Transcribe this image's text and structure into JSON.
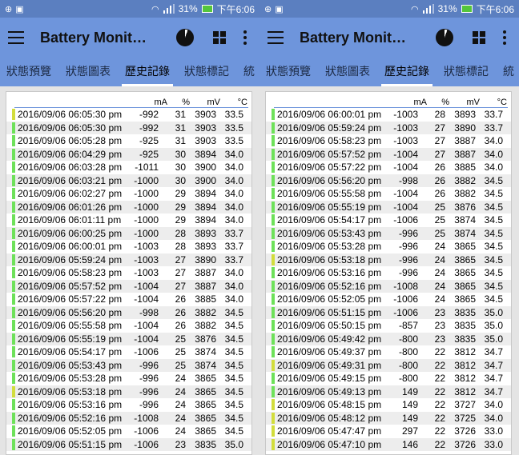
{
  "status_bar": {
    "battery_percent": "31%",
    "time": "下午6:06"
  },
  "app_bar": {
    "title": "Battery Monit…"
  },
  "tabs": [
    "狀態預覽",
    "狀態圖表",
    "歷史記錄",
    "狀態標記",
    "統"
  ],
  "active_tab": 2,
  "headers": {
    "ma": "mA",
    "pct": "%",
    "mv": "mV",
    "temp": "°C"
  },
  "colors": {
    "bar": "#6e95dc",
    "status": "#5b7fc0",
    "green": "#6ee15a",
    "yellow": "#d2dd3c"
  },
  "left_rows": [
    [
      "2016/09/06  06:05:30 pm",
      "-992",
      "31",
      "3903",
      "33.5",
      "yellow"
    ],
    [
      "2016/09/06  06:05:30 pm",
      "-992",
      "31",
      "3903",
      "33.5",
      "green"
    ],
    [
      "2016/09/06  06:05:28 pm",
      "-925",
      "31",
      "3903",
      "33.5",
      "green"
    ],
    [
      "2016/09/06  06:04:29 pm",
      "-925",
      "30",
      "3894",
      "34.0",
      "green"
    ],
    [
      "2016/09/06  06:03:28 pm",
      "-1011",
      "30",
      "3900",
      "34.0",
      "green"
    ],
    [
      "2016/09/06  06:03:21 pm",
      "-1000",
      "30",
      "3900",
      "34.0",
      "green"
    ],
    [
      "2016/09/06  06:02:27 pm",
      "-1000",
      "29",
      "3894",
      "34.0",
      "green"
    ],
    [
      "2016/09/06  06:01:26 pm",
      "-1000",
      "29",
      "3894",
      "34.0",
      "green"
    ],
    [
      "2016/09/06  06:01:11 pm",
      "-1000",
      "29",
      "3894",
      "34.0",
      "green"
    ],
    [
      "2016/09/06  06:00:25 pm",
      "-1000",
      "28",
      "3893",
      "33.7",
      "green"
    ],
    [
      "2016/09/06  06:00:01 pm",
      "-1003",
      "28",
      "3893",
      "33.7",
      "green"
    ],
    [
      "2016/09/06  05:59:24 pm",
      "-1003",
      "27",
      "3890",
      "33.7",
      "green"
    ],
    [
      "2016/09/06  05:58:23 pm",
      "-1003",
      "27",
      "3887",
      "34.0",
      "green"
    ],
    [
      "2016/09/06  05:57:52 pm",
      "-1004",
      "27",
      "3887",
      "34.0",
      "green"
    ],
    [
      "2016/09/06  05:57:22 pm",
      "-1004",
      "26",
      "3885",
      "34.0",
      "green"
    ],
    [
      "2016/09/06  05:56:20 pm",
      "-998",
      "26",
      "3882",
      "34.5",
      "green"
    ],
    [
      "2016/09/06  05:55:58 pm",
      "-1004",
      "26",
      "3882",
      "34.5",
      "green"
    ],
    [
      "2016/09/06  05:55:19 pm",
      "-1004",
      "25",
      "3876",
      "34.5",
      "green"
    ],
    [
      "2016/09/06  05:54:17 pm",
      "-1006",
      "25",
      "3874",
      "34.5",
      "green"
    ],
    [
      "2016/09/06  05:53:43 pm",
      "-996",
      "25",
      "3874",
      "34.5",
      "green"
    ],
    [
      "2016/09/06  05:53:28 pm",
      "-996",
      "24",
      "3865",
      "34.5",
      "green"
    ],
    [
      "2016/09/06  05:53:18 pm",
      "-996",
      "24",
      "3865",
      "34.5",
      "yellow"
    ],
    [
      "2016/09/06  05:53:16 pm",
      "-996",
      "24",
      "3865",
      "34.5",
      "green"
    ],
    [
      "2016/09/06  05:52:16 pm",
      "-1008",
      "24",
      "3865",
      "34.5",
      "green"
    ],
    [
      "2016/09/06  05:52:05 pm",
      "-1006",
      "24",
      "3865",
      "34.5",
      "green"
    ],
    [
      "2016/09/06  05:51:15 pm",
      "-1006",
      "23",
      "3835",
      "35.0",
      "green"
    ]
  ],
  "right_rows": [
    [
      "2016/09/06  06:00:01 pm",
      "-1003",
      "28",
      "3893",
      "33.7",
      "green"
    ],
    [
      "2016/09/06  05:59:24 pm",
      "-1003",
      "27",
      "3890",
      "33.7",
      "green"
    ],
    [
      "2016/09/06  05:58:23 pm",
      "-1003",
      "27",
      "3887",
      "34.0",
      "green"
    ],
    [
      "2016/09/06  05:57:52 pm",
      "-1004",
      "27",
      "3887",
      "34.0",
      "green"
    ],
    [
      "2016/09/06  05:57:22 pm",
      "-1004",
      "26",
      "3885",
      "34.0",
      "green"
    ],
    [
      "2016/09/06  05:56:20 pm",
      "-998",
      "26",
      "3882",
      "34.5",
      "green"
    ],
    [
      "2016/09/06  05:55:58 pm",
      "-1004",
      "26",
      "3882",
      "34.5",
      "green"
    ],
    [
      "2016/09/06  05:55:19 pm",
      "-1004",
      "25",
      "3876",
      "34.5",
      "green"
    ],
    [
      "2016/09/06  05:54:17 pm",
      "-1006",
      "25",
      "3874",
      "34.5",
      "green"
    ],
    [
      "2016/09/06  05:53:43 pm",
      "-996",
      "25",
      "3874",
      "34.5",
      "green"
    ],
    [
      "2016/09/06  05:53:28 pm",
      "-996",
      "24",
      "3865",
      "34.5",
      "green"
    ],
    [
      "2016/09/06  05:53:18 pm",
      "-996",
      "24",
      "3865",
      "34.5",
      "yellow"
    ],
    [
      "2016/09/06  05:53:16 pm",
      "-996",
      "24",
      "3865",
      "34.5",
      "green"
    ],
    [
      "2016/09/06  05:52:16 pm",
      "-1008",
      "24",
      "3865",
      "34.5",
      "green"
    ],
    [
      "2016/09/06  05:52:05 pm",
      "-1006",
      "24",
      "3865",
      "34.5",
      "green"
    ],
    [
      "2016/09/06  05:51:15 pm",
      "-1006",
      "23",
      "3835",
      "35.0",
      "green"
    ],
    [
      "2016/09/06  05:50:15 pm",
      "-857",
      "23",
      "3835",
      "35.0",
      "green"
    ],
    [
      "2016/09/06  05:49:42 pm",
      "-800",
      "23",
      "3835",
      "35.0",
      "green"
    ],
    [
      "2016/09/06  05:49:37 pm",
      "-800",
      "22",
      "3812",
      "34.7",
      "green"
    ],
    [
      "2016/09/06  05:49:31 pm",
      "-800",
      "22",
      "3812",
      "34.7",
      "yellow"
    ],
    [
      "2016/09/06  05:49:15 pm",
      "-800",
      "22",
      "3812",
      "34.7",
      "green"
    ],
    [
      "2016/09/06  05:49:13 pm",
      "149",
      "22",
      "3812",
      "34.7",
      "green"
    ],
    [
      "2016/09/06  05:48:15 pm",
      "149",
      "22",
      "3727",
      "34.0",
      "yellow"
    ],
    [
      "2016/09/06  05:48:12 pm",
      "149",
      "22",
      "3725",
      "34.0",
      "yellow"
    ],
    [
      "2016/09/06  05:47:47 pm",
      "297",
      "22",
      "3726",
      "33.0",
      "yellow"
    ],
    [
      "2016/09/06  05:47:10 pm",
      "146",
      "22",
      "3726",
      "33.0",
      "yellow"
    ]
  ]
}
